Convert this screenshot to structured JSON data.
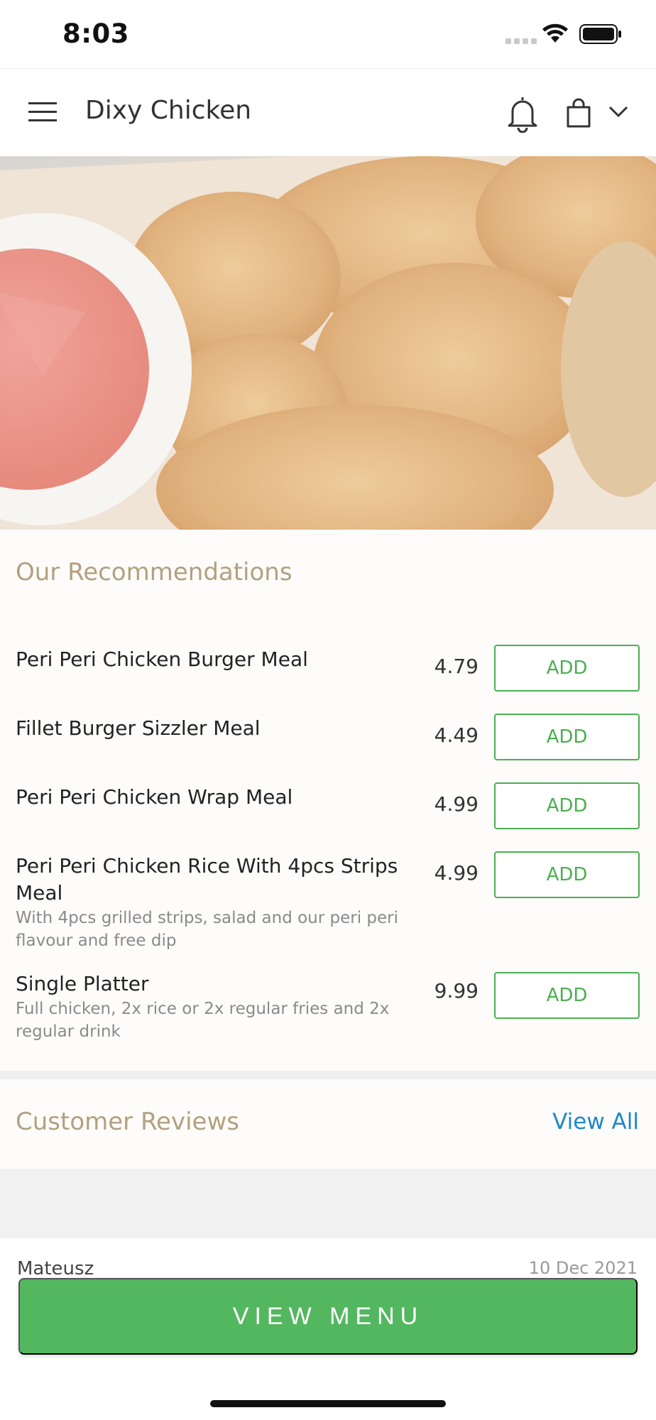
{
  "status_bar": {
    "time": "8:03"
  },
  "header": {
    "title": "Dixy Chicken"
  },
  "recommendations": {
    "title": "Our Recommendations",
    "items": [
      {
        "name": "Peri Peri Chicken Burger Meal",
        "description": "",
        "price": "4.79",
        "button": "ADD"
      },
      {
        "name": "Fillet Burger Sizzler Meal",
        "description": "",
        "price": "4.49",
        "button": "ADD"
      },
      {
        "name": "Peri Peri Chicken Wrap Meal",
        "description": "",
        "price": "4.99",
        "button": "ADD"
      },
      {
        "name": "Peri Peri Chicken Rice With 4pcs Strips Meal",
        "description": "With 4pcs grilled strips, salad and our peri peri flavour and free dip",
        "price": "4.99",
        "button": "ADD"
      },
      {
        "name": "Single Platter",
        "description": "Full chicken, 2x rice or 2x regular fries and 2x regular drink",
        "price": "9.99",
        "button": "ADD"
      }
    ]
  },
  "reviews": {
    "title": "Customer Reviews",
    "view_all": "View All",
    "first_review": {
      "name": "Mateusz",
      "date": "10 Dec 2021"
    }
  },
  "footer": {
    "view_menu_label": "VIEW MENU"
  },
  "colors": {
    "accent_green": "#53b75f",
    "link_blue": "#1e88c7",
    "section_title": "#b3a07e"
  },
  "icons": [
    "menu-icon",
    "bell-icon",
    "shopping-bag-icon",
    "chevron-down-icon",
    "wifi-icon",
    "battery-icon"
  ]
}
